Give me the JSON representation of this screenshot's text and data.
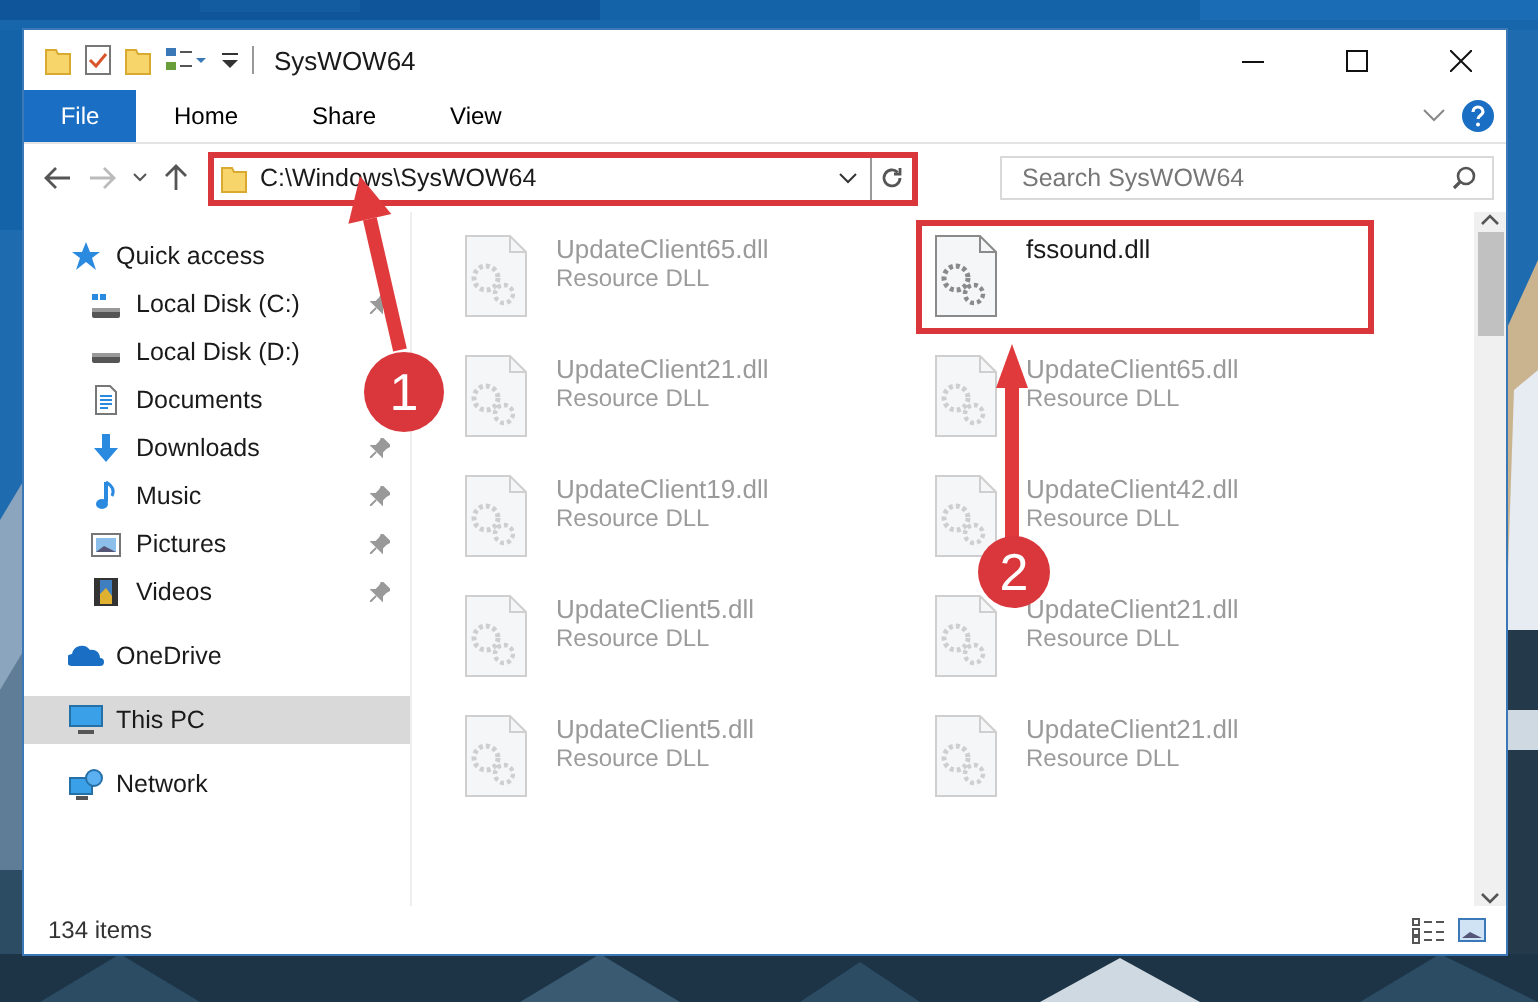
{
  "window": {
    "title": "SysWOW64"
  },
  "ribbon": {
    "file_tab": "File",
    "tabs": [
      "Home",
      "Share",
      "View"
    ]
  },
  "address": {
    "path": "C:\\Windows\\SysWOW64",
    "highlighted": true
  },
  "search": {
    "placeholder": "Search SysWOW64"
  },
  "sidebar": {
    "items": [
      {
        "label": "Quick access",
        "kind": "quick-access",
        "selected": false,
        "children": [
          {
            "label": "Local Disk (C:)",
            "kind": "disk-system",
            "pinned": true,
            "selected": false
          },
          {
            "label": "Local Disk (D:)",
            "kind": "disk",
            "selected": false
          },
          {
            "label": "Documents",
            "kind": "documents",
            "selected": false
          },
          {
            "label": "Downloads",
            "kind": "downloads",
            "pinned": true,
            "selected": false
          },
          {
            "label": "Music",
            "kind": "music",
            "pinned": true,
            "selected": false
          },
          {
            "label": "Pictures",
            "kind": "pictures",
            "pinned": true,
            "selected": false
          },
          {
            "label": "Videos",
            "kind": "videos",
            "pinned": true,
            "selected": false
          }
        ]
      },
      {
        "label": "OneDrive",
        "kind": "cloud",
        "selected": false
      },
      {
        "label": "This PC",
        "kind": "pc",
        "selected": true
      },
      {
        "label": "Network",
        "kind": "network",
        "selected": false
      }
    ]
  },
  "files": [
    {
      "name": "UpdateClient65.dll",
      "type": "Resource DLL",
      "blurred": true,
      "highlighted": false
    },
    {
      "name": "fssound.dll",
      "blurred": false,
      "highlighted": true
    },
    {
      "name": "UpdateClient21.dll",
      "type": "Resource DLL",
      "blurred": true,
      "highlighted": false
    },
    {
      "name": "UpdateClient65.dll",
      "type": "Resource DLL",
      "blurred": true,
      "highlighted": false
    },
    {
      "name": "UpdateClient19.dll",
      "type": "Resource DLL",
      "blurred": true,
      "highlighted": false
    },
    {
      "name": "UpdateClient42.dll",
      "type": "Resource DLL",
      "blurred": true,
      "highlighted": false
    },
    {
      "name": "UpdateClient5.dll",
      "type": "Resource DLL",
      "blurred": true,
      "highlighted": false
    },
    {
      "name": "UpdateClient21.dll",
      "type": "Resource DLL",
      "blurred": true,
      "highlighted": false
    },
    {
      "name": "UpdateClient5.dll",
      "type": "Resource DLL",
      "blurred": true,
      "highlighted": false
    },
    {
      "name": "UpdateClient21.dll",
      "type": "Resource DLL",
      "blurred": true,
      "highlighted": false
    }
  ],
  "status_bar": {
    "item_count": "134 items"
  },
  "callouts": [
    {
      "number": "1"
    },
    {
      "number": "2"
    }
  ]
}
